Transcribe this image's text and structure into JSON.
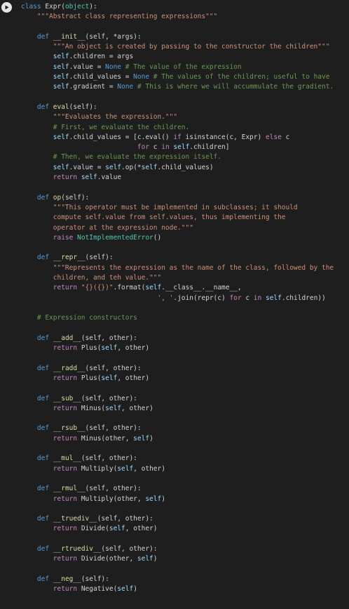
{
  "cell": {
    "run_button_icon": "play-icon",
    "colors": {
      "background": "#1e1e1e",
      "keyword": "#569cd6",
      "string": "#ce9178",
      "comment": "#6a9955",
      "identifier": "#9cdcfe",
      "builtin": "#4ec9b0",
      "default": "#d4d4d4"
    },
    "code_lines": [
      [
        [
          "keyword",
          "class "
        ],
        [
          "plain",
          "Expr("
        ],
        [
          "builtin",
          "object"
        ],
        [
          "plain",
          "):"
        ]
      ],
      [
        [
          "plain",
          "    "
        ],
        [
          "string",
          "\"\"\"Abstract class representing expressions\"\"\""
        ]
      ],
      [],
      [
        [
          "plain",
          "    "
        ],
        [
          "keyword",
          "def "
        ],
        [
          "defname",
          "__init__"
        ],
        [
          "plain",
          "(self, *args):"
        ]
      ],
      [
        [
          "plain",
          "        "
        ],
        [
          "string",
          "\"\"\"An object is created by passing to the constructor the children\"\"\""
        ]
      ],
      [
        [
          "plain",
          "        "
        ],
        [
          "self",
          "self"
        ],
        [
          "plain",
          ".children = args"
        ]
      ],
      [
        [
          "plain",
          "        "
        ],
        [
          "self",
          "self"
        ],
        [
          "plain",
          ".value = "
        ],
        [
          "const",
          "None"
        ],
        [
          "plain",
          " "
        ],
        [
          "comment",
          "# The value of the expression"
        ]
      ],
      [
        [
          "plain",
          "        "
        ],
        [
          "self",
          "self"
        ],
        [
          "plain",
          ".child_values = "
        ],
        [
          "const",
          "None"
        ],
        [
          "plain",
          " "
        ],
        [
          "comment",
          "# The values of the children; useful to have"
        ]
      ],
      [
        [
          "plain",
          "        "
        ],
        [
          "self",
          "self"
        ],
        [
          "plain",
          ".gradient = "
        ],
        [
          "const",
          "None"
        ],
        [
          "plain",
          " "
        ],
        [
          "comment",
          "# This is where we will accummulate the gradient."
        ]
      ],
      [],
      [
        [
          "plain",
          "    "
        ],
        [
          "keyword",
          "def "
        ],
        [
          "defname",
          "eval"
        ],
        [
          "plain",
          "(self):"
        ]
      ],
      [
        [
          "plain",
          "        "
        ],
        [
          "string",
          "\"\"\"Evaluates the expression.\"\"\""
        ]
      ],
      [
        [
          "plain",
          "        "
        ],
        [
          "comment",
          "# First, we evaluate the children."
        ]
      ],
      [
        [
          "plain",
          "        "
        ],
        [
          "self",
          "self"
        ],
        [
          "plain",
          ".child_values = [c.eval() "
        ],
        [
          "ctrl",
          "if"
        ],
        [
          "plain",
          " isinstance(c, Expr) "
        ],
        [
          "ctrl",
          "else"
        ],
        [
          "plain",
          " c"
        ]
      ],
      [
        [
          "plain",
          "                             "
        ],
        [
          "ctrl",
          "for"
        ],
        [
          "plain",
          " c "
        ],
        [
          "ctrl",
          "in"
        ],
        [
          "plain",
          " "
        ],
        [
          "self",
          "self"
        ],
        [
          "plain",
          ".children]"
        ]
      ],
      [
        [
          "plain",
          "        "
        ],
        [
          "comment",
          "# Then, we evaluate the expression itself."
        ]
      ],
      [
        [
          "plain",
          "        "
        ],
        [
          "self",
          "self"
        ],
        [
          "plain",
          ".value = "
        ],
        [
          "self",
          "self"
        ],
        [
          "plain",
          ".op(*"
        ],
        [
          "self",
          "self"
        ],
        [
          "plain",
          ".child_values)"
        ]
      ],
      [
        [
          "plain",
          "        "
        ],
        [
          "ctrl",
          "return"
        ],
        [
          "plain",
          " "
        ],
        [
          "self",
          "self"
        ],
        [
          "plain",
          ".value"
        ]
      ],
      [],
      [
        [
          "plain",
          "    "
        ],
        [
          "keyword",
          "def "
        ],
        [
          "defname",
          "op"
        ],
        [
          "plain",
          "(self):"
        ]
      ],
      [
        [
          "plain",
          "        "
        ],
        [
          "string",
          "\"\"\"This operator must be implemented in subclasses; it should"
        ]
      ],
      [
        [
          "string",
          "        compute self.value from self.values, thus implementing the"
        ]
      ],
      [
        [
          "string",
          "        operator at the expression node.\"\"\""
        ]
      ],
      [
        [
          "plain",
          "        "
        ],
        [
          "ctrl",
          "raise"
        ],
        [
          "plain",
          " "
        ],
        [
          "builtin",
          "NotImplementedError"
        ],
        [
          "plain",
          "()"
        ]
      ],
      [],
      [
        [
          "plain",
          "    "
        ],
        [
          "keyword",
          "def "
        ],
        [
          "defname",
          "__repr__"
        ],
        [
          "plain",
          "(self):"
        ]
      ],
      [
        [
          "plain",
          "        "
        ],
        [
          "string",
          "\"\"\"Represents the expression as the name of the class, followed by the"
        ]
      ],
      [
        [
          "string",
          "        children, and teh value.\"\"\""
        ]
      ],
      [
        [
          "plain",
          "        "
        ],
        [
          "ctrl",
          "return"
        ],
        [
          "plain",
          " "
        ],
        [
          "string",
          "\"{}({})\""
        ],
        [
          "plain",
          ".format("
        ],
        [
          "self",
          "self"
        ],
        [
          "plain",
          ".__class__.__name__,"
        ]
      ],
      [
        [
          "plain",
          "                                  "
        ],
        [
          "string",
          "', '"
        ],
        [
          "plain",
          ".join(repr(c) "
        ],
        [
          "ctrl",
          "for"
        ],
        [
          "plain",
          " c "
        ],
        [
          "ctrl",
          "in"
        ],
        [
          "plain",
          " "
        ],
        [
          "self",
          "self"
        ],
        [
          "plain",
          ".children))"
        ]
      ],
      [],
      [
        [
          "plain",
          "    "
        ],
        [
          "comment",
          "# Expression constructors"
        ]
      ],
      [],
      [
        [
          "plain",
          "    "
        ],
        [
          "keyword",
          "def "
        ],
        [
          "defname",
          "__add__"
        ],
        [
          "plain",
          "(self, other):"
        ]
      ],
      [
        [
          "plain",
          "        "
        ],
        [
          "ctrl",
          "return"
        ],
        [
          "plain",
          " Plus("
        ],
        [
          "self",
          "self"
        ],
        [
          "plain",
          ", other)"
        ]
      ],
      [],
      [
        [
          "plain",
          "    "
        ],
        [
          "keyword",
          "def "
        ],
        [
          "defname",
          "__radd__"
        ],
        [
          "plain",
          "(self, other):"
        ]
      ],
      [
        [
          "plain",
          "        "
        ],
        [
          "ctrl",
          "return"
        ],
        [
          "plain",
          " Plus("
        ],
        [
          "self",
          "self"
        ],
        [
          "plain",
          ", other)"
        ]
      ],
      [],
      [
        [
          "plain",
          "    "
        ],
        [
          "keyword",
          "def "
        ],
        [
          "defname",
          "__sub__"
        ],
        [
          "plain",
          "(self, other):"
        ]
      ],
      [
        [
          "plain",
          "        "
        ],
        [
          "ctrl",
          "return"
        ],
        [
          "plain",
          " Minus("
        ],
        [
          "self",
          "self"
        ],
        [
          "plain",
          ", other)"
        ]
      ],
      [],
      [
        [
          "plain",
          "    "
        ],
        [
          "keyword",
          "def "
        ],
        [
          "defname",
          "__rsub__"
        ],
        [
          "plain",
          "(self, other):"
        ]
      ],
      [
        [
          "plain",
          "        "
        ],
        [
          "ctrl",
          "return"
        ],
        [
          "plain",
          " Minus(other, "
        ],
        [
          "self",
          "self"
        ],
        [
          "plain",
          ")"
        ]
      ],
      [],
      [
        [
          "plain",
          "    "
        ],
        [
          "keyword",
          "def "
        ],
        [
          "defname",
          "__mul__"
        ],
        [
          "plain",
          "(self, other):"
        ]
      ],
      [
        [
          "plain",
          "        "
        ],
        [
          "ctrl",
          "return"
        ],
        [
          "plain",
          " Multiply("
        ],
        [
          "self",
          "self"
        ],
        [
          "plain",
          ", other)"
        ]
      ],
      [],
      [
        [
          "plain",
          "    "
        ],
        [
          "keyword",
          "def "
        ],
        [
          "defname",
          "__rmul__"
        ],
        [
          "plain",
          "(self, other):"
        ]
      ],
      [
        [
          "plain",
          "        "
        ],
        [
          "ctrl",
          "return"
        ],
        [
          "plain",
          " Multiply(other, "
        ],
        [
          "self",
          "self"
        ],
        [
          "plain",
          ")"
        ]
      ],
      [],
      [
        [
          "plain",
          "    "
        ],
        [
          "keyword",
          "def "
        ],
        [
          "defname",
          "__truediv__"
        ],
        [
          "plain",
          "(self, other):"
        ]
      ],
      [
        [
          "plain",
          "        "
        ],
        [
          "ctrl",
          "return"
        ],
        [
          "plain",
          " Divide("
        ],
        [
          "self",
          "self"
        ],
        [
          "plain",
          ", other)"
        ]
      ],
      [],
      [
        [
          "plain",
          "    "
        ],
        [
          "keyword",
          "def "
        ],
        [
          "defname",
          "__rtruediv__"
        ],
        [
          "plain",
          "(self, other):"
        ]
      ],
      [
        [
          "plain",
          "        "
        ],
        [
          "ctrl",
          "return"
        ],
        [
          "plain",
          " Divide(other, "
        ],
        [
          "self",
          "self"
        ],
        [
          "plain",
          ")"
        ]
      ],
      [],
      [
        [
          "plain",
          "    "
        ],
        [
          "keyword",
          "def "
        ],
        [
          "defname",
          "__neg__"
        ],
        [
          "plain",
          "(self):"
        ]
      ],
      [
        [
          "plain",
          "        "
        ],
        [
          "ctrl",
          "return"
        ],
        [
          "plain",
          " Negative("
        ],
        [
          "self",
          "self"
        ],
        [
          "plain",
          ")"
        ]
      ]
    ]
  }
}
